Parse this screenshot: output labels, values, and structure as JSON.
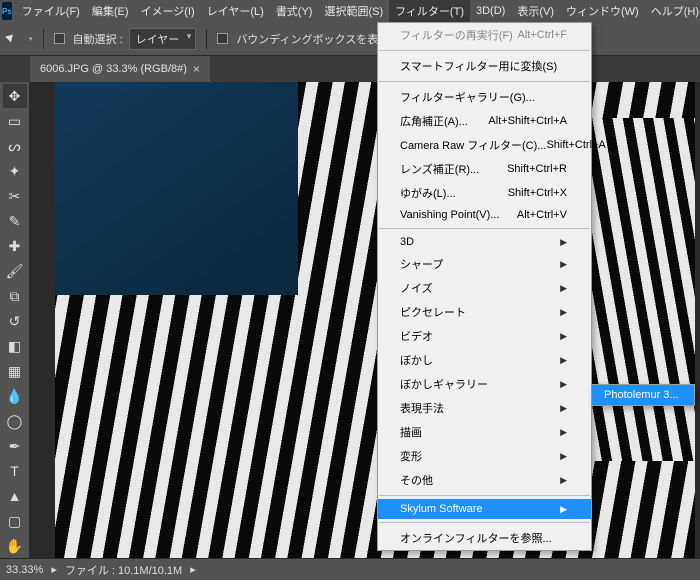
{
  "menubar": {
    "items": [
      {
        "label": "ファイル(F)"
      },
      {
        "label": "編集(E)"
      },
      {
        "label": "イメージ(I)"
      },
      {
        "label": "レイヤー(L)"
      },
      {
        "label": "書式(Y)"
      },
      {
        "label": "選択範囲(S)"
      },
      {
        "label": "フィルター(T)"
      },
      {
        "label": "3D(D)"
      },
      {
        "label": "表示(V)"
      },
      {
        "label": "ウィンドウ(W)"
      },
      {
        "label": "ヘルプ(H)"
      }
    ]
  },
  "optbar": {
    "auto_select": "自動選択 :",
    "layer_select": "レイヤー",
    "show_bbox": "バウンディングボックスを表示"
  },
  "tab": {
    "title": "6006.JPG @ 33.3% (RGB/8#)"
  },
  "status": {
    "zoom": "33.33%",
    "file": "ファイル : 10.1M/10.1M"
  },
  "filter_menu": {
    "rerun": "フィルターの再実行(F)",
    "rerun_key": "Alt+Ctrl+F",
    "smart": "スマートフィルター用に変換(S)",
    "gallery": "フィルターギャラリー(G)...",
    "wide": "広角補正(A)...",
    "wide_key": "Alt+Shift+Ctrl+A",
    "camera": "Camera Raw フィルター(C)...",
    "camera_key": "Shift+Ctrl+A",
    "lens": "レンズ補正(R)...",
    "lens_key": "Shift+Ctrl+R",
    "liquify": "ゆがみ(L)...",
    "liquify_key": "Shift+Ctrl+X",
    "vanishing": "Vanishing Point(V)...",
    "vanishing_key": "Alt+Ctrl+V",
    "cat_3d": "3D",
    "cat_sharp": "シャープ",
    "cat_noise": "ノイズ",
    "cat_pixel": "ピクセレート",
    "cat_video": "ビデオ",
    "cat_blur": "ぼかし",
    "cat_blurg": "ぼかしギャラリー",
    "cat_stylize": "表現手法",
    "cat_render": "描画",
    "cat_distort": "変形",
    "cat_other": "その他",
    "skylum": "Skylum Software",
    "browse": "オンラインフィルターを参照..."
  },
  "submenu": {
    "item": "Photolemur 3..."
  }
}
